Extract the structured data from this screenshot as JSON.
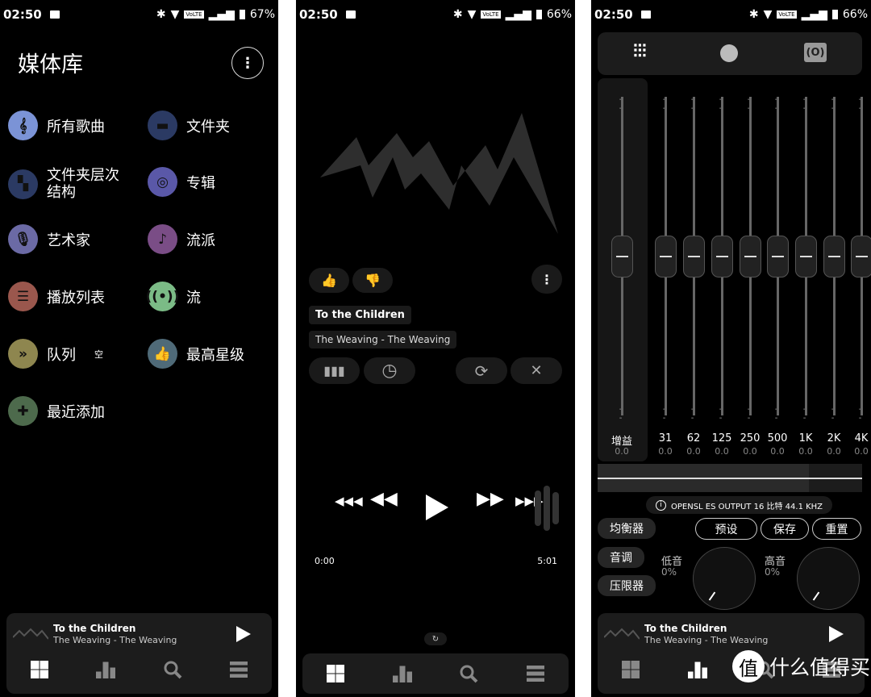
{
  "status": [
    {
      "time": "02:50",
      "battery": "67%"
    },
    {
      "time": "02:50",
      "battery": "66%"
    },
    {
      "time": "02:50",
      "battery": "66%"
    }
  ],
  "status_volte": "VoLTE",
  "library": {
    "title": "媒体库",
    "items": [
      {
        "label": "所有歌曲",
        "icon": "treble-clef-icon",
        "glyph": "𝄞",
        "color": "#7b93d6"
      },
      {
        "label": "文件夹",
        "icon": "folder-icon",
        "glyph": "▬",
        "color": "#2b3a63"
      },
      {
        "label": "文件夹层次结构",
        "icon": "folder-hierarchy-icon",
        "glyph": "▚",
        "color": "#2b3a63"
      },
      {
        "label": "专辑",
        "icon": "disc-icon",
        "glyph": "◎",
        "color": "#5a58a8"
      },
      {
        "label": "艺术家",
        "icon": "microphone-icon",
        "glyph": "🎙",
        "color": "#6b6aa5"
      },
      {
        "label": "流派",
        "icon": "guitar-icon",
        "glyph": "♪",
        "color": "#7a4d86"
      },
      {
        "label": "播放列表",
        "icon": "list-icon",
        "glyph": "☰",
        "color": "#9a574d"
      },
      {
        "label": "流",
        "icon": "stream-icon",
        "glyph": "((•))",
        "color": "#7bbb86"
      },
      {
        "label": "队列",
        "sub": "空",
        "icon": "queue-icon",
        "glyph": "»",
        "color": "#8e864f"
      },
      {
        "label": "最高星级",
        "icon": "thumbs-up-icon",
        "glyph": "👍",
        "color": "#4f6a78"
      },
      {
        "label": "最近添加",
        "icon": "plus-icon",
        "glyph": "✚",
        "color": "#4d6a4c"
      }
    ]
  },
  "now_playing": {
    "title": "To the Children",
    "artist_album": "The Weaving - The Weaving",
    "elapsed": "0:00",
    "duration": "5:01"
  },
  "equalizer": {
    "bands": [
      {
        "label": "增益",
        "value": "0.0"
      },
      {
        "label": "31",
        "value": "0.0"
      },
      {
        "label": "62",
        "value": "0.0"
      },
      {
        "label": "125",
        "value": "0.0"
      },
      {
        "label": "250",
        "value": "0.0"
      },
      {
        "label": "500",
        "value": "0.0"
      },
      {
        "label": "1K",
        "value": "0.0"
      },
      {
        "label": "2K",
        "value": "0.0"
      },
      {
        "label": "4K",
        "value": "0.0"
      }
    ],
    "output_info": "OPENSL ES OUTPUT  16 比特  44.1 KHZ",
    "tabs": [
      "均衡器",
      "音调",
      "压限器"
    ],
    "actions": [
      "预设",
      "保存",
      "重置"
    ],
    "bass_label": "低音",
    "bass_value": "0%",
    "treble_label": "高音",
    "treble_value": "0%"
  },
  "watermark": {
    "badge": "值",
    "text": "什么值得买"
  }
}
